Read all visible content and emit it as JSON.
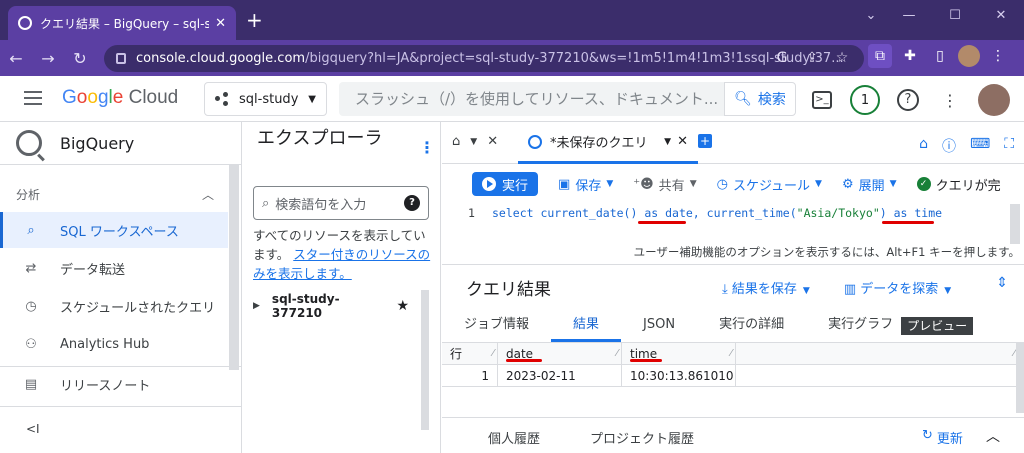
{
  "browser": {
    "tab_title": "クエリ結果 – BigQuery – sql-study",
    "tab_close": "✕",
    "new_tab": "+",
    "url_host": "console.cloud.google.com",
    "url_rest": "/bigquery?hl=JA&project=sql-study-377210&ws=!1m5!1m4!1m3!1ssql-study-37..."
  },
  "header": {
    "logo_google": [
      "G",
      "o",
      "o",
      "g",
      "l",
      "e"
    ],
    "logo_cloud": "Cloud",
    "project": "sql-study",
    "search_placeholder": "スラッシュ（/）を使用してリソース、ドキュメント...",
    "search_button": "検索",
    "notifications": "1"
  },
  "sidebar": {
    "product": "BigQuery",
    "section": "分析",
    "items": [
      {
        "label": "SQL ワークスペース"
      },
      {
        "label": "データ転送"
      },
      {
        "label": "スケジュールされたクエリ"
      },
      {
        "label": "Analytics Hub"
      },
      {
        "label": "リリースノート"
      }
    ],
    "collapse": "<I"
  },
  "explorer": {
    "title": "エクスプローラ",
    "search_placeholder": "検索語句を入力",
    "info_text": "すべてのリソースを表示しています。",
    "info_link": "スター付きのリソースのみを表示します。",
    "project": "sql-study-377210"
  },
  "workspace": {
    "tab_name": "*未保存のクエリ",
    "toolbar": {
      "run": "実行",
      "save": "保存",
      "share": "共有",
      "schedule": "スケジュール",
      "deploy": "展開",
      "status": "クエリが完"
    },
    "editor": {
      "line": "1",
      "code_a": "select current_date() ",
      "code_b": "as date",
      "code_c": ", current_time(",
      "code_str": "\"Asia/Tokyo\"",
      "code_d": ") ",
      "code_e": "as time",
      "hint": "ユーザー補助機能のオプションを表示するには、Alt+F1 キーを押します。"
    }
  },
  "results": {
    "title": "クエリ結果",
    "save_results": "結果を保存",
    "explore_data": "データを探索",
    "tabs": [
      "ジョブ情報",
      "結果",
      "JSON",
      "実行の詳細",
      "実行グラフ"
    ],
    "preview_badge": "プレビュー",
    "columns": [
      "行",
      "date",
      "time"
    ],
    "rows": [
      {
        "row": "1",
        "date": "2023-02-11",
        "time": "10:30:13.861010"
      }
    ],
    "history_personal": "個人履歴",
    "history_project": "プロジェクト履歴",
    "refresh": "更新"
  },
  "colors": {
    "chrome_dark": "#3b2d6b",
    "chrome_tab": "#5b3fa3",
    "accent": "#1a73e8",
    "annotation_red": "#e00000"
  }
}
